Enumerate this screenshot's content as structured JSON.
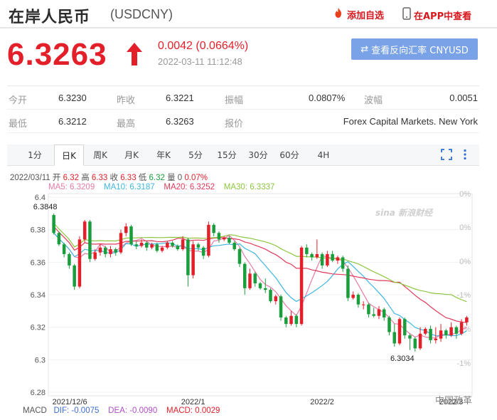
{
  "header": {
    "title": "在岸人民币",
    "code": "(USDCNY)",
    "add_favorite": "添加自选",
    "view_in_app": "在APP中查看"
  },
  "quote": {
    "price": "6.3263",
    "change": "0.0042 (0.0664%)",
    "timestamp": "2022-03-11 11:12:48",
    "reverse_rate_button": "查看反向汇率 CNYUSD"
  },
  "stats": {
    "row1": [
      {
        "label": "今开",
        "value": "6.3230"
      },
      {
        "label": "昨收",
        "value": "6.3221"
      },
      {
        "label": "振幅",
        "value": "0.0807%"
      },
      {
        "label": "波幅",
        "value": "0.0051"
      }
    ],
    "row2": [
      {
        "label": "最低",
        "value": "6.3212"
      },
      {
        "label": "最高",
        "value": "6.3263"
      },
      {
        "label": "报价",
        "value": "Forex Capital Markets. New York"
      }
    ]
  },
  "tabs": [
    "1分",
    "日K",
    "周K",
    "月K",
    "年K",
    "5分",
    "15分",
    "30分",
    "60分",
    "4H"
  ],
  "active_tab": "日K",
  "info": {
    "date": "2022/03/11",
    "open_label": "开",
    "open": "6.32",
    "high_label": "高",
    "high": "6.33",
    "close_label": "收",
    "close": "6.33",
    "low_label": "低",
    "low": "6.32",
    "vol_label": "量",
    "vol": "0",
    "pct": "0.07%",
    "ma5": "MA5: 6.3209",
    "ma10": "MA10: 6.3187",
    "ma20": "MA20: 6.3252",
    "ma30": "MA30: 6.3337"
  },
  "macd": {
    "label": "MACD",
    "dif": "DIF: -0.0075",
    "dea": "DEA: -0.0090",
    "macd": "MACD: 0.0029"
  },
  "colors": {
    "up": "#e3202a",
    "down": "#1a9e3c",
    "ma5": "#e87aa6",
    "ma10": "#3db6e0",
    "ma20": "#e03a5a",
    "ma30": "#8cc63f",
    "button": "#7aa2e6"
  },
  "chart_data": {
    "type": "candlestick",
    "y_ticks": [
      "6.4",
      "6.38",
      "6.36",
      "6.34",
      "6.32",
      "6.3",
      "6.28"
    ],
    "ylim": [
      6.28,
      6.4
    ],
    "right_ticks": [
      "0%",
      "0%",
      "0%",
      "-1%",
      "-1%",
      "-1%"
    ],
    "x_ticks": [
      "2021/12/6",
      "2022/1",
      "2022/2",
      "2022/3"
    ],
    "max_annotation": "6.3848",
    "min_annotation": "6.3034",
    "watermark": "sina 新浪财经",
    "bottom_watermark": "中国政革",
    "candles": [
      [
        6.389,
        6.378,
        6.39,
        6.377
      ],
      [
        6.378,
        6.371,
        6.379,
        6.37
      ],
      [
        6.371,
        6.365,
        6.372,
        6.363
      ],
      [
        6.365,
        6.358,
        6.366,
        6.356
      ],
      [
        6.358,
        6.345,
        6.359,
        6.343
      ],
      [
        6.345,
        6.374,
        6.376,
        6.344
      ],
      [
        6.374,
        6.385,
        6.386,
        6.372
      ],
      [
        6.385,
        6.362,
        6.386,
        6.36
      ],
      [
        6.362,
        6.366,
        6.368,
        6.361
      ],
      [
        6.366,
        6.369,
        6.371,
        6.364
      ],
      [
        6.369,
        6.365,
        6.37,
        6.363
      ],
      [
        6.365,
        6.368,
        6.37,
        6.363
      ],
      [
        6.368,
        6.366,
        6.369,
        6.364
      ],
      [
        6.366,
        6.378,
        6.38,
        6.365
      ],
      [
        6.378,
        6.382,
        6.384,
        6.376
      ],
      [
        6.382,
        6.371,
        6.383,
        6.37
      ],
      [
        6.371,
        6.37,
        6.373,
        6.368
      ],
      [
        6.37,
        6.372,
        6.374,
        6.369
      ],
      [
        6.372,
        6.369,
        6.373,
        6.367
      ],
      [
        6.369,
        6.371,
        6.372,
        6.368
      ],
      [
        6.371,
        6.367,
        6.372,
        6.366
      ],
      [
        6.367,
        6.369,
        6.37,
        6.366
      ],
      [
        6.369,
        6.372,
        6.373,
        6.368
      ],
      [
        6.372,
        6.37,
        6.373,
        6.369
      ],
      [
        6.37,
        6.368,
        6.371,
        6.367
      ],
      [
        6.368,
        6.374,
        6.376,
        6.367
      ],
      [
        6.374,
        6.352,
        6.375,
        6.345
      ],
      [
        6.352,
        6.371,
        6.373,
        6.35
      ],
      [
        6.371,
        6.369,
        6.372,
        6.367
      ],
      [
        6.369,
        6.364,
        6.37,
        6.362
      ],
      [
        6.364,
        6.383,
        6.385,
        6.363
      ],
      [
        6.383,
        6.378,
        6.384,
        6.376
      ],
      [
        6.378,
        6.374,
        6.379,
        6.372
      ],
      [
        6.374,
        6.375,
        6.376,
        6.373
      ],
      [
        6.375,
        6.372,
        6.376,
        6.371
      ],
      [
        6.372,
        6.368,
        6.373,
        6.367
      ],
      [
        6.368,
        6.359,
        6.369,
        6.357
      ],
      [
        6.359,
        6.344,
        6.36,
        6.34
      ],
      [
        6.344,
        6.353,
        6.356,
        6.343
      ],
      [
        6.353,
        6.347,
        6.354,
        6.345
      ],
      [
        6.347,
        6.344,
        6.348,
        6.343
      ],
      [
        6.344,
        6.343,
        6.35,
        6.341
      ],
      [
        6.343,
        6.336,
        6.344,
        6.335
      ],
      [
        6.336,
        6.339,
        6.34,
        6.334
      ],
      [
        6.339,
        6.326,
        6.34,
        6.324
      ],
      [
        6.326,
        6.322,
        6.327,
        6.32
      ],
      [
        6.322,
        6.327,
        6.33,
        6.321
      ],
      [
        6.327,
        6.322,
        6.328,
        6.32
      ],
      [
        6.322,
        6.369,
        6.37,
        6.321
      ],
      [
        6.369,
        6.365,
        6.371,
        6.363
      ],
      [
        6.365,
        6.363,
        6.366,
        6.361
      ],
      [
        6.363,
        6.365,
        6.374,
        6.362
      ],
      [
        6.365,
        6.358,
        6.366,
        6.356
      ],
      [
        6.358,
        6.365,
        6.367,
        6.357
      ],
      [
        6.365,
        6.361,
        6.367,
        6.36
      ],
      [
        6.361,
        6.363,
        6.364,
        6.359
      ],
      [
        6.363,
        6.356,
        6.364,
        6.354
      ],
      [
        6.356,
        6.338,
        6.358,
        6.336
      ],
      [
        6.338,
        6.34,
        6.342,
        6.337
      ],
      [
        6.34,
        6.334,
        6.341,
        6.332
      ],
      [
        6.334,
        6.334,
        6.336,
        6.331
      ],
      [
        6.334,
        6.328,
        6.335,
        6.326
      ],
      [
        6.328,
        6.327,
        6.332,
        6.326
      ],
      [
        6.327,
        6.331,
        6.333,
        6.325
      ],
      [
        6.331,
        6.326,
        6.332,
        6.324
      ],
      [
        6.326,
        6.317,
        6.327,
        6.315
      ],
      [
        6.317,
        6.31,
        6.322,
        6.308
      ],
      [
        6.31,
        6.325,
        6.326,
        6.309
      ],
      [
        6.325,
        6.315,
        6.326,
        6.313
      ],
      [
        6.315,
        6.313,
        6.316,
        6.306
      ],
      [
        6.313,
        6.307,
        6.314,
        6.305
      ],
      [
        6.307,
        6.316,
        6.32,
        6.306
      ],
      [
        6.316,
        6.319,
        6.32,
        6.315
      ],
      [
        6.319,
        6.312,
        6.321,
        6.31
      ],
      [
        6.312,
        6.313,
        6.32,
        6.31
      ],
      [
        6.313,
        6.318,
        6.322,
        6.311
      ],
      [
        6.318,
        6.315,
        6.319,
        6.313
      ],
      [
        6.315,
        6.32,
        6.323,
        6.314
      ],
      [
        6.32,
        6.316,
        6.321,
        6.313
      ],
      [
        6.316,
        6.323,
        6.325,
        6.315
      ],
      [
        6.323,
        6.326,
        6.327,
        6.321
      ]
    ]
  }
}
